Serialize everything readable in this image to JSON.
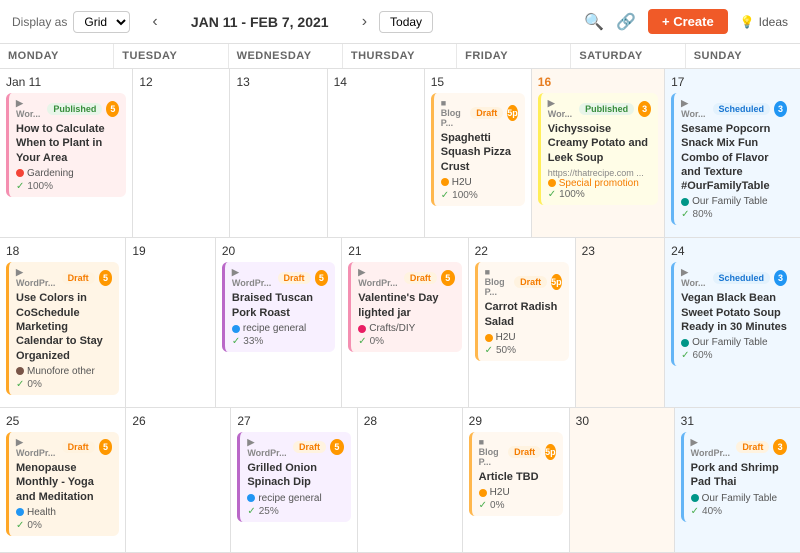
{
  "header": {
    "display_as_label": "Display as",
    "grid_option": "Grid",
    "date_range": "JAN 11 - FEB 7, 2021",
    "today_btn": "Today",
    "create_btn": "+ Create",
    "ideas_btn": "Ideas"
  },
  "weekdays": [
    "MONDAY",
    "TUESDAY",
    "WEDNESDAY",
    "THURSDAY",
    "FRIDAY",
    "SATURDAY",
    "SUNDAY"
  ],
  "weeks": [
    {
      "days": [
        {
          "num": "Jan 11",
          "is_date_label": true,
          "cards": [
            {
              "platform": "Wor...",
              "wp": true,
              "badge": "Published",
              "badge_num": "5",
              "num_color": "orange",
              "title": "How to Calculate When to Plant in Your Area",
              "tag_dot": "red",
              "tag": "Gardening",
              "progress": "100%",
              "color": "pink"
            }
          ]
        },
        {
          "num": "12",
          "cards": []
        },
        {
          "num": "13",
          "cards": []
        },
        {
          "num": "14",
          "cards": []
        },
        {
          "num": "15",
          "cards": [
            {
              "platform": "Blog P...",
              "wp": false,
              "badge": "Draft",
              "badge_num": "5p",
              "num_color": "orange",
              "title": "Spaghetti Squash Pizza Crust",
              "tag_dot": "orange",
              "tag": "H2U",
              "progress": "100%",
              "color": "orange"
            }
          ]
        },
        {
          "num": "16",
          "is_saturday": true,
          "cards": [
            {
              "platform": "Wor...",
              "wp": true,
              "badge": "Published",
              "badge_num": "3",
              "num_color": "orange",
              "title": "Vichyssoise Creamy Potato and Leek Soup",
              "url": "https://thatrecipe.com ...",
              "special_tag": "Special promotion",
              "progress": "100%",
              "color": "yellow"
            }
          ]
        },
        {
          "num": "17",
          "cards": [
            {
              "platform": "Wor...",
              "wp": true,
              "badge": "Scheduled",
              "badge_num": "3",
              "num_color": "blue",
              "title": "Sesame Popcorn Snack Mix Fun Combo of Flavor and Texture #OurFamilyTable",
              "tag_dot": "teal",
              "tag": "Our Family Table",
              "progress": "80%",
              "color": "blue"
            }
          ]
        }
      ]
    },
    {
      "days": [
        {
          "num": "18",
          "cards": [
            {
              "platform": "WordPr...",
              "wp": true,
              "badge": "Draft",
              "badge_num": "5",
              "num_color": "orange",
              "title": "Use Colors in CoSchedule Marketing Calendar to Stay Organized",
              "tag_dot": "brown",
              "tag": "Munofore other",
              "progress": "0%",
              "color": "light-orange"
            }
          ]
        },
        {
          "num": "19",
          "cards": []
        },
        {
          "num": "20",
          "cards": [
            {
              "platform": "WordPr...",
              "wp": true,
              "badge": "Draft",
              "badge_num": "5",
              "num_color": "orange",
              "title": "Braised Tuscan Pork Roast",
              "tag_dot": "blue",
              "tag": "recipe general",
              "progress": "33%",
              "color": "purple"
            }
          ]
        },
        {
          "num": "21",
          "cards": [
            {
              "platform": "WordPr...",
              "wp": true,
              "badge": "Draft",
              "badge_num": "5",
              "num_color": "orange",
              "title": "Valentine's Day lighted jar",
              "tag_dot": "pink",
              "tag": "Crafts/DIY",
              "progress": "0%",
              "color": "pink"
            }
          ]
        },
        {
          "num": "22",
          "cards": [
            {
              "platform": "Blog P...",
              "wp": false,
              "badge": "Draft",
              "badge_num": "5p",
              "num_color": "orange",
              "title": "Carrot Radish Salad",
              "tag_dot": "orange",
              "tag": "H2U",
              "progress": "50%",
              "color": "orange"
            }
          ]
        },
        {
          "num": "23",
          "cards": [],
          "is_saturday": true
        },
        {
          "num": "24",
          "cards": [
            {
              "platform": "Wor...",
              "wp": true,
              "badge": "Scheduled",
              "badge_num": "3",
              "num_color": "blue",
              "title": "Vegan Black Bean Sweet Potato Soup Ready in 30 Minutes",
              "tag_dot": "teal",
              "tag": "Our Family Table",
              "progress": "60%",
              "color": "blue"
            }
          ]
        }
      ]
    },
    {
      "days": [
        {
          "num": "25",
          "cards": [
            {
              "platform": "WordPr...",
              "wp": true,
              "badge": "Draft",
              "badge_num": "5",
              "num_color": "orange",
              "title": "Menopause Monthly - Yoga and Meditation",
              "tag_dot": "blue",
              "tag": "Health",
              "progress": "0%",
              "color": "light-orange"
            }
          ]
        },
        {
          "num": "26",
          "cards": []
        },
        {
          "num": "27",
          "cards": [
            {
              "platform": "WordPr...",
              "wp": true,
              "badge": "Draft",
              "badge_num": "5",
              "num_color": "orange",
              "title": "Grilled Onion Spinach Dip",
              "tag_dot": "blue",
              "tag": "recipe general",
              "progress": "25%",
              "color": "purple"
            }
          ]
        },
        {
          "num": "28",
          "cards": []
        },
        {
          "num": "29",
          "cards": [
            {
              "platform": "Blog P...",
              "wp": false,
              "badge": "Draft",
              "badge_num": "5p",
              "num_color": "orange",
              "title": "Article TBD",
              "tag_dot": "orange",
              "tag": "H2U",
              "progress": "0%",
              "color": "orange"
            }
          ]
        },
        {
          "num": "30",
          "cards": [],
          "is_saturday": true
        },
        {
          "num": "31",
          "cards": [
            {
              "platform": "WordPr...",
              "wp": true,
              "badge": "Draft",
              "badge_num": "3",
              "num_color": "orange",
              "title": "Pork and Shrimp Pad Thai",
              "tag_dot": "teal",
              "tag": "Our Family Table",
              "progress": "40%",
              "color": "blue"
            }
          ]
        }
      ]
    }
  ]
}
